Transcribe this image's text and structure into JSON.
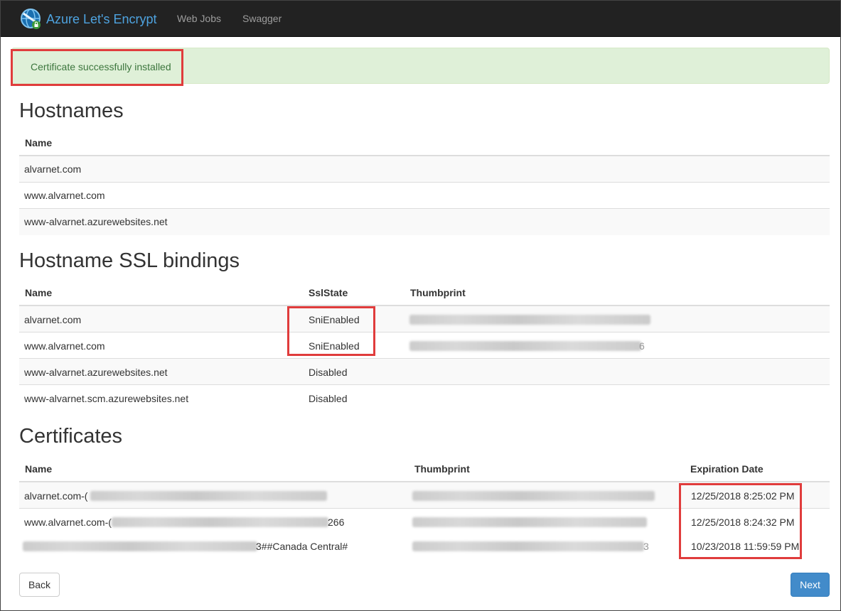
{
  "navbar": {
    "brand": "Azure Let's Encrypt",
    "links": [
      "Web Jobs",
      "Swagger"
    ],
    "logo_icon": "globe-shield-icon"
  },
  "alert": {
    "message": "Certificate successfully installed"
  },
  "hostnames": {
    "title": "Hostnames",
    "columns": [
      "Name"
    ],
    "rows": [
      "alvarnet.com",
      "www.alvarnet.com",
      "www-alvarnet.azurewebsites.net"
    ]
  },
  "ssl_bindings": {
    "title": "Hostname SSL bindings",
    "columns": [
      "Name",
      "SslState",
      "Thumbprint"
    ],
    "rows": [
      {
        "name": "alvarnet.com",
        "state": "SniEnabled",
        "thumbprint": "",
        "thumb_tail": ""
      },
      {
        "name": "www.alvarnet.com",
        "state": "SniEnabled",
        "thumbprint": "",
        "thumb_tail": "6"
      },
      {
        "name": "www-alvarnet.azurewebsites.net",
        "state": "Disabled",
        "thumbprint": ""
      },
      {
        "name": "www-alvarnet.scm.azurewebsites.net",
        "state": "Disabled",
        "thumbprint": ""
      }
    ]
  },
  "certificates": {
    "title": "Certificates",
    "columns": [
      "Name",
      "Thumbprint",
      "Expiration Date"
    ],
    "rows": [
      {
        "name_prefix": "alvarnet.com-(",
        "name_suffix": "",
        "thumb_tail": "",
        "expiration": "12/25/2018 8:25:02 PM"
      },
      {
        "name_prefix": "www.alvarnet.com-(",
        "name_suffix": "266",
        "thumb_tail": "",
        "expiration": "12/25/2018 8:24:32 PM"
      },
      {
        "name_prefix": "",
        "name_suffix": "3##Canada Central#",
        "thumb_tail": "3",
        "expiration": "10/23/2018 11:59:59 PM"
      }
    ]
  },
  "buttons": {
    "back": "Back",
    "next": "Next"
  },
  "colors": {
    "highlight": "#e03c3c",
    "primary": "#428bca",
    "success_bg": "#dff0d8",
    "success_text": "#3c763d"
  }
}
